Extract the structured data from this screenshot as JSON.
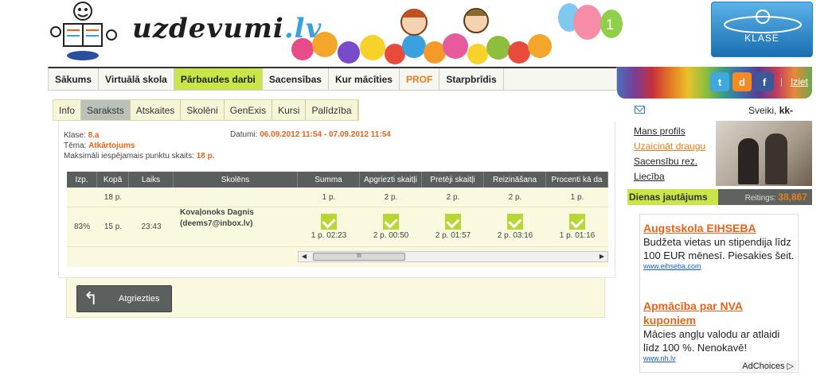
{
  "brand": {
    "logo_main": "uzdevumi",
    "logo_tld": ".lv",
    "balloon_number": "1",
    "eklase": "KLASE"
  },
  "main_nav": [
    {
      "label": "Sākums"
    },
    {
      "label": "Virtuālā skola"
    },
    {
      "label": "Pārbaudes darbi",
      "active": true
    },
    {
      "label": "Sacensības"
    },
    {
      "label": "Kur mācīties"
    },
    {
      "label": "PROF"
    },
    {
      "label": "Starpbrīdis"
    }
  ],
  "social": {
    "twitter": "t",
    "draugiem": "d",
    "facebook": "f",
    "logout": "Iziet"
  },
  "sub_nav": [
    "Info",
    "Saraksts",
    "Atskaites",
    "Skolēni",
    "GenExis",
    "Kursi",
    "Palīdzība"
  ],
  "info": {
    "class_label": "Klase:",
    "class_value": "8.a",
    "topic_label": "Tēma:",
    "topic_value": "Atkārtojums",
    "max_label": "Maksimāli iespējamais punktu skaits:",
    "max_value": "18 p.",
    "dates_label": "Datumi:",
    "dates_value": "06.09.2012 11:54 - 07.09.2012 11:54"
  },
  "grid": {
    "headers": [
      "Izp.",
      "Kopā",
      "Laiks",
      "Skolēns",
      "Summa",
      "Apgriezti skaitļi",
      "Pretēji skaitļi",
      "Reizināšana",
      "Procenti kā da"
    ],
    "max_row": [
      "",
      "18 p.",
      "",
      "",
      "1 p.",
      "2 p.",
      "2 p.",
      "2 p.",
      "1 p."
    ],
    "student_row": {
      "pct": "83%",
      "total": "15 p.",
      "time": "23:43",
      "name": "Kovaļonoks Dagnis",
      "email": "(deems7@inbox.lv)",
      "results": [
        "1 p. 02:23",
        "2 p. 00:50",
        "2 p. 01:57",
        "2 p. 03:16",
        "1 p. 01:16"
      ]
    },
    "scroll_thumb": "III"
  },
  "back_button": "Atgriezties",
  "sidebar": {
    "greeting_prefix": "Sveiki,",
    "user": "kk-",
    "links": [
      {
        "label": "Mans profils"
      },
      {
        "label": "Uzaicināt draugu",
        "orange": true
      },
      {
        "label": "Sacensību rez."
      },
      {
        "label": "Liecība"
      }
    ],
    "daily_title": "Dienas jautājums",
    "rating_label": "Reitings:",
    "rating_value": "38,867"
  },
  "ads": [
    {
      "title": "Augstskola EIHSEBA",
      "desc": "Budžeta vietas un stipendija līdz 100 EUR mēnesī. Piesakies šeit.",
      "url": "www.eihseba.com"
    },
    {
      "title": "Apmācība par NVA kuponiem",
      "desc": "Mācies angļu valodu ar atlaidi līdz 100 %. Nenokavē!",
      "url": "www.nh.lv"
    }
  ],
  "adchoices": "AdChoices ▷"
}
